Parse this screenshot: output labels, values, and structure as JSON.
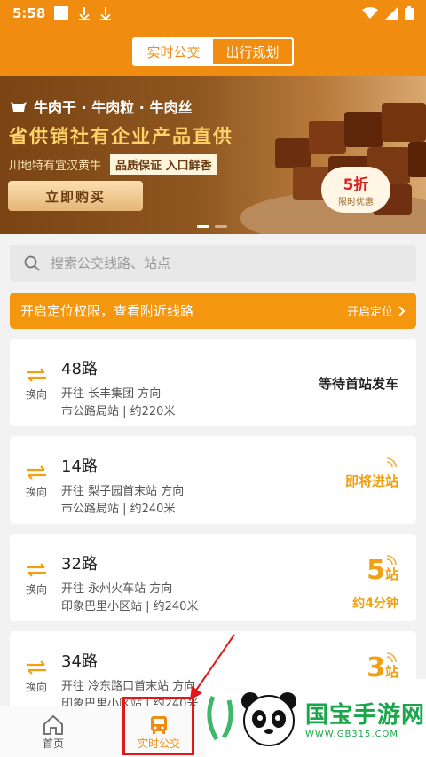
{
  "status_bar": {
    "time": "5:58"
  },
  "header": {
    "tabs": [
      {
        "label": "实时公交",
        "active": true
      },
      {
        "label": "出行规划",
        "active": false
      }
    ]
  },
  "banner": {
    "line1": "牛肉干 · 牛肉粒 · 牛肉丝",
    "line2": "省供销社有企业产品直供",
    "line3_left": "川地特有宜汉黄牛",
    "line3_tag1": "品质保证",
    "line3_tag2": "入口鲜香",
    "buy_label": "立即购买",
    "discount_main": "5折",
    "discount_sub": "限时优惠"
  },
  "search": {
    "placeholder": "搜索公交线路、站点"
  },
  "location_bar": {
    "text": "开启定位权限，查看附近线路",
    "action": "开启定位"
  },
  "swap_label": "换向",
  "routes": [
    {
      "name": "48路",
      "direction": "开往 长丰集团 方向",
      "stop": "市公路局站 | 约220米",
      "status": "等待首站发车"
    },
    {
      "name": "14路",
      "direction": "开往 梨子园首末站 方向",
      "stop": "市公路局站 | 约240米",
      "status": "即将进站"
    },
    {
      "name": "32路",
      "direction": "开往 永州火车站 方向",
      "stop": "印象巴里小区站 | 约240米",
      "stations": "5",
      "unit": "站",
      "eta": "约4分钟"
    },
    {
      "name": "34路",
      "direction": "开往 冷东路口首末站 方向",
      "stop": "印象巴里小区站 | 约240米",
      "stations": "3",
      "unit": "站"
    }
  ],
  "tabbar": {
    "home": "首页",
    "realtime": "实时公交"
  },
  "watermark": {
    "title": "国宝手游网",
    "url": "WWW.GB315.COM"
  },
  "colors": {
    "primary": "#f08c0f",
    "accent": "#f0a010",
    "highlight": "#e01818"
  }
}
